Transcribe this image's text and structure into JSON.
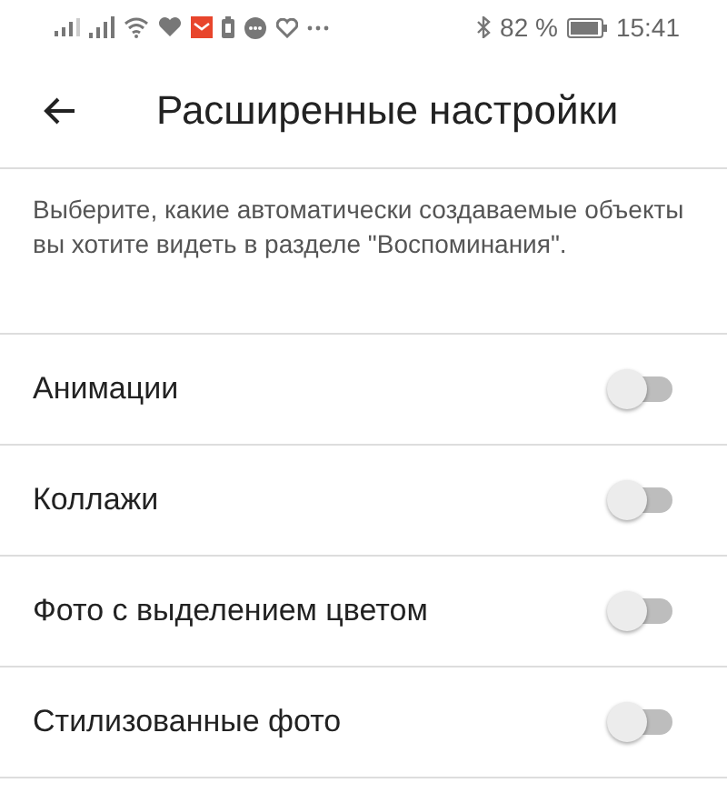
{
  "status_bar": {
    "battery_percent": "82 %",
    "time": "15:41"
  },
  "header": {
    "title": "Расширенные настройки"
  },
  "description": "Выберите, какие автоматически создаваемые объекты вы хотите видеть в разделе \"Воспоминания\".",
  "settings": [
    {
      "label": "Анимации",
      "on": false
    },
    {
      "label": "Коллажи",
      "on": false
    },
    {
      "label": "Фото с выделением цветом",
      "on": false
    },
    {
      "label": "Стилизованные фото",
      "on": false
    }
  ]
}
